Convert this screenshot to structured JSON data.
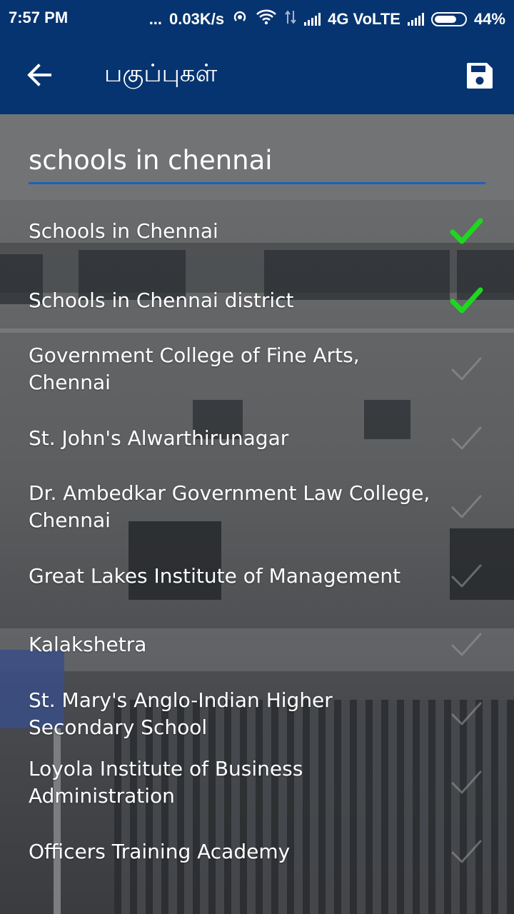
{
  "status_bar": {
    "time": "7:57 PM",
    "dots": "...",
    "speed": "0.03K/s",
    "network": "4G VoLTE",
    "battery": "44%"
  },
  "app_bar": {
    "title": "பகுப்புகள்",
    "back_icon": "arrow-back-icon",
    "save_icon": "save-icon"
  },
  "search": {
    "value": "schools in chennai",
    "placeholder": ""
  },
  "colors": {
    "app_bar": "#063470",
    "accent": "#1b62c0",
    "check_on": "#1ed81e",
    "check_off": "#9a9a9a"
  },
  "results": [
    {
      "label": "Schools in Chennai",
      "checked": true
    },
    {
      "label": "Schools in Chennai district",
      "checked": true
    },
    {
      "label": "Government College of Fine Arts, Chennai",
      "checked": false
    },
    {
      "label": "St. John's Alwarthirunagar",
      "checked": false
    },
    {
      "label": "Dr. Ambedkar Government Law College, Chennai",
      "checked": false
    },
    {
      "label": "Great Lakes Institute of Management",
      "checked": false
    },
    {
      "label": "Kalakshetra",
      "checked": false
    },
    {
      "label": "St. Mary's Anglo-Indian Higher Secondary School",
      "checked": false
    },
    {
      "label": "Loyola Institute of Business Administration",
      "checked": false
    },
    {
      "label": "Officers Training Academy",
      "checked": false
    }
  ]
}
